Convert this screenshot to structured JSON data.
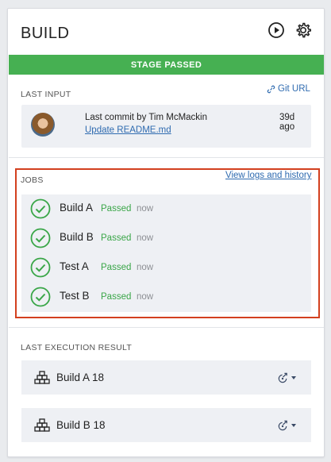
{
  "stage": {
    "title": "BUILD",
    "banner": "STAGE PASSED",
    "colors": {
      "passed_green": "#46b052",
      "link_blue": "#2f6bb0",
      "highlight_red": "#d3401f"
    }
  },
  "header": {
    "icons": [
      "play-icon",
      "gear-icon"
    ]
  },
  "last_input": {
    "label": "LAST INPUT",
    "git_url_label": "Git URL",
    "commit_text": "Last commit by Tim McMackin",
    "commit_link": "Update README.md",
    "age": "39d ago"
  },
  "jobs": {
    "label": "JOBS",
    "view_logs_label": "View logs and history",
    "items": [
      {
        "name": "Build A",
        "status": "Passed",
        "when": "now"
      },
      {
        "name": "Build B",
        "status": "Passed",
        "when": "now"
      },
      {
        "name": "Test A",
        "status": "Passed",
        "when": "now"
      },
      {
        "name": "Test B",
        "status": "Passed",
        "when": "now"
      }
    ]
  },
  "last_execution": {
    "label": "LAST EXECUTION RESULT",
    "items": [
      {
        "name": "Build A 18"
      },
      {
        "name": "Build B 18"
      }
    ]
  }
}
